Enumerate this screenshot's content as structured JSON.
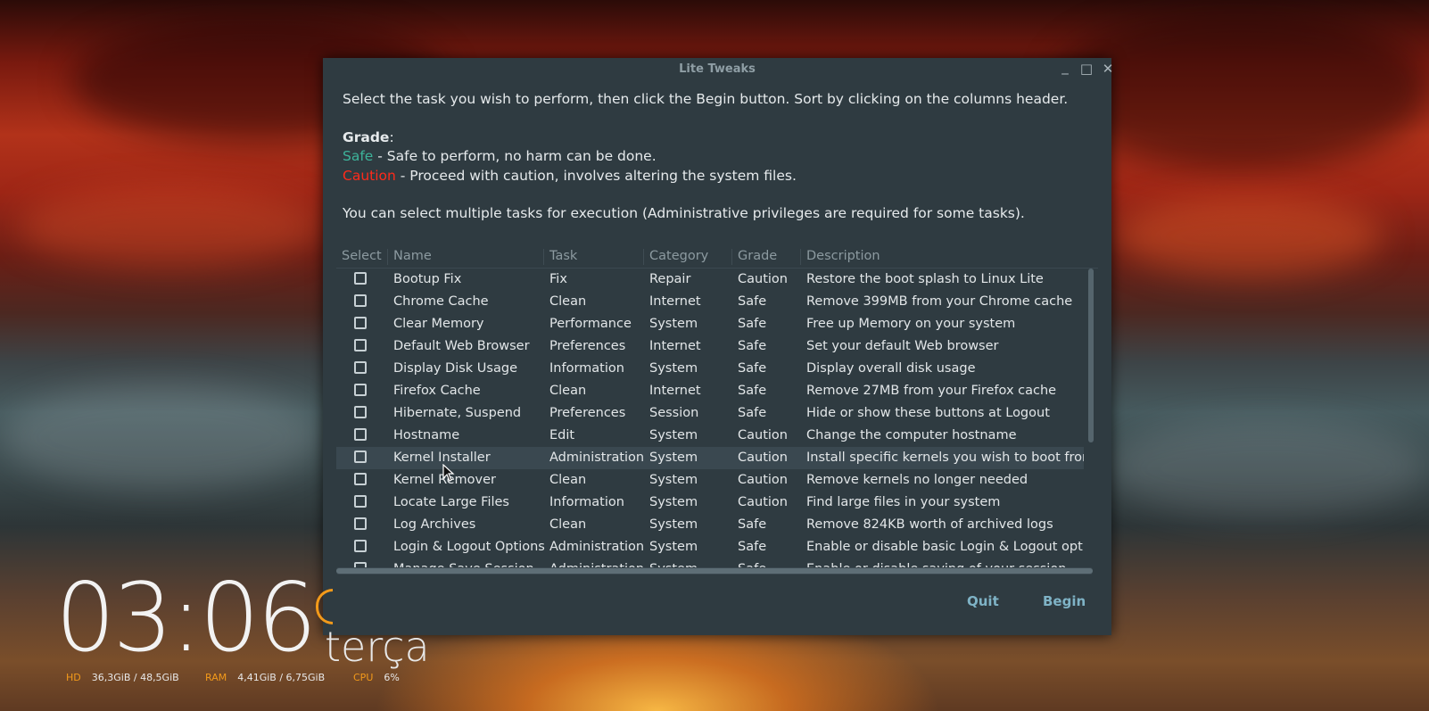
{
  "window": {
    "title": "Lite Tweaks",
    "intro_line": "Select the task you wish to perform, then click the Begin button. Sort by clicking on the columns header.",
    "grade_label": "Grade",
    "grade_colon": ":",
    "safe_word": "Safe",
    "safe_desc": " - Safe to perform, no harm can be done.",
    "caution_word": "Caution",
    "caution_desc": " - Proceed with caution, involves altering the system files.",
    "multi_line": "You can select multiple tasks for execution (Administrative privileges are required for some tasks).",
    "quit_label": "Quit",
    "begin_label": "Begin",
    "controls": {
      "minimize": "_",
      "maximize": "□",
      "close": "✕"
    }
  },
  "table": {
    "headers": {
      "select": "Select",
      "name": "Name",
      "task": "Task",
      "category": "Category",
      "grade": "Grade",
      "description": "Description"
    },
    "rows": [
      {
        "name": "Bootup Fix",
        "task": "Fix",
        "category": "Repair",
        "grade": "Caution",
        "description": "Restore the boot splash to Linux Lite"
      },
      {
        "name": "Chrome Cache",
        "task": "Clean",
        "category": "Internet",
        "grade": "Safe",
        "description": "Remove 399MB from your Chrome cache"
      },
      {
        "name": "Clear Memory",
        "task": "Performance",
        "category": "System",
        "grade": "Safe",
        "description": "Free up Memory on your system"
      },
      {
        "name": "Default Web Browser",
        "task": "Preferences",
        "category": "Internet",
        "grade": "Safe",
        "description": "Set your default Web browser"
      },
      {
        "name": "Display Disk Usage",
        "task": "Information",
        "category": "System",
        "grade": "Safe",
        "description": "Display overall disk usage"
      },
      {
        "name": "Firefox Cache",
        "task": "Clean",
        "category": "Internet",
        "grade": "Safe",
        "description": "Remove 27MB from your Firefox cache"
      },
      {
        "name": "Hibernate, Suspend",
        "task": "Preferences",
        "category": "Session",
        "grade": "Safe",
        "description": "Hide or show these buttons at Logout"
      },
      {
        "name": "Hostname",
        "task": "Edit",
        "category": "System",
        "grade": "Caution",
        "description": "Change the computer hostname"
      },
      {
        "name": "Kernel Installer",
        "task": "Administration",
        "category": "System",
        "grade": "Caution",
        "description": "Install specific kernels you wish to boot from"
      },
      {
        "name": "Kernel Remover",
        "task": "Clean",
        "category": "System",
        "grade": "Caution",
        "description": "Remove kernels no longer needed"
      },
      {
        "name": "Locate Large Files",
        "task": "Information",
        "category": "System",
        "grade": "Caution",
        "description": "Find large files in your system"
      },
      {
        "name": "Log Archives",
        "task": "Clean",
        "category": "System",
        "grade": "Safe",
        "description": "Remove 824KB worth of archived logs"
      },
      {
        "name": "Login & Logout Options",
        "task": "Administration",
        "category": "System",
        "grade": "Safe",
        "description": "Enable or disable basic Login & Logout options"
      },
      {
        "name": "Manage Save Session",
        "task": "Administration",
        "category": "System",
        "grade": "Safe",
        "description": "Enable or disable saving of your session"
      }
    ],
    "highlighted_row": "Kernel Installer"
  },
  "desktop": {
    "clock_time": "03:06",
    "weekday": "terça",
    "hd_label": "HD",
    "hd_value": "36,3GiB / 48,5GiB",
    "ram_label": "RAM",
    "ram_value": "4,41GiB / 6,75GiB",
    "cpu_label": "CPU",
    "cpu_value": "6%"
  },
  "colors": {
    "window_bg": "#2f3b41",
    "safe": "#3db39a",
    "caution": "#ff2a1a",
    "button": "#7fb3c6",
    "conky_accent": "#f39a1a"
  }
}
